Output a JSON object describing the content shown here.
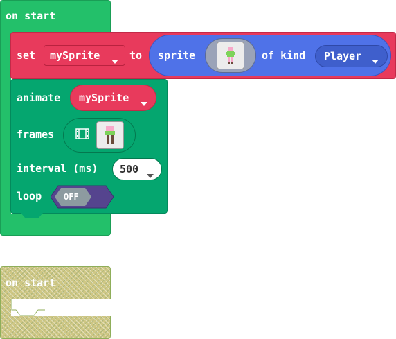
{
  "blocks": {
    "on_start_1": {
      "label": "on start"
    },
    "set": {
      "keyword": "set",
      "variable": "mySprite",
      "to": "to",
      "sprite_label": "sprite",
      "of_kind_label": "of kind",
      "kind": "Player"
    },
    "animate": {
      "label": "animate",
      "variable": "mySprite",
      "frames_label": "frames",
      "interval_label": "interval (ms)",
      "interval_value": "500",
      "loop_label": "loop",
      "loop_state": "OFF"
    },
    "on_start_2": {
      "label": "on start"
    }
  },
  "icons": {
    "film": "film-icon",
    "dropdown": "chevron-down-icon"
  },
  "colors": {
    "event_green": "#23c06a",
    "variable_red": "#e83a5c",
    "sprite_blue": "#4f72e8",
    "animation_teal": "#05a66f",
    "toggle_purple": "#55448e"
  }
}
